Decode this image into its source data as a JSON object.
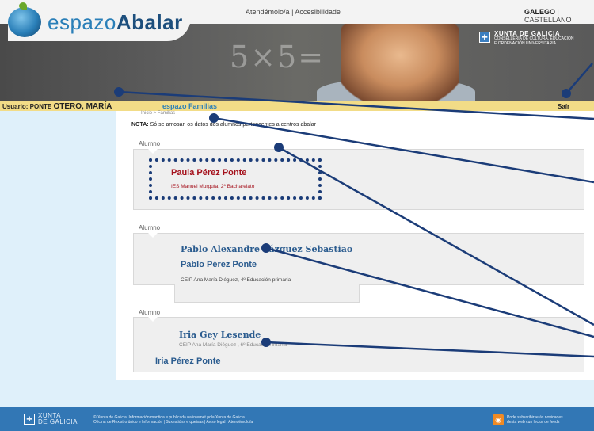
{
  "header": {
    "logo_prefix": "espazo",
    "logo_brand": "Abalar",
    "board_text": "5×5=",
    "links": [
      "Atendémolo/a",
      "Accesibilidade"
    ],
    "lang_active": "GALEGO",
    "lang_other": "CASTELLANO",
    "xunta_title": "XUNTA DE GALICIA",
    "xunta_sub1": "CONSELLERÍA DE CULTURA, EDUCACIÓN",
    "xunta_sub2": "E ORDENACIÓN UNIVERSITARIA"
  },
  "userbar": {
    "user_label": "Usuario: PONTE ",
    "user_bold": "OTERO, MARÍA",
    "section": "espazo Familias",
    "logout": "Saír"
  },
  "breadcrumb": "Inicio > Familias",
  "nota": {
    "label": "NOTA:",
    "text": "Só se amosan os datos dos alumnos pertencentes a centros abalar"
  },
  "students": [
    {
      "section_label": "Alumno",
      "overlay_name": "",
      "name": "Paula Pérez Ponte",
      "school": "IES Manuel Murguía,  2º Bacharelato",
      "color": "#a5121d"
    },
    {
      "section_label": "Alumno",
      "overlay_name": "Pablo Alexandre Vázquez Sebastiao",
      "name": "Pablo Pérez Ponte",
      "school": "CEIP Ana María Diéguez, 4º Educación primaria",
      "color": "#2b5c8f"
    },
    {
      "section_label": "Alumno",
      "overlay_name": "Iria Gey Lesende",
      "name": "Iria Pérez Ponte",
      "school": "CEIP Ana María Diéguez , 6º Educación infantil",
      "color": "#2b5c8f"
    }
  ],
  "footer": {
    "xunta_line1": "XUNTA",
    "xunta_line2": "DE GALICIA",
    "copyright_line1": "© Xunta de Galicia. Información mantida e publicada na internet pola Xunta de Galicia",
    "copyright_line2": "Oficina de Rexistro único e Información | Suxestións e queixas | Aviso legal | Atendémolo/a",
    "rss_line1": "Pode subscribirse ás novidades",
    "rss_line2": "desta web cun lector de feeds"
  },
  "colors": {
    "annotation": "#1b3c78",
    "userbar": "#f2dc87",
    "footer": "#3277b5"
  }
}
